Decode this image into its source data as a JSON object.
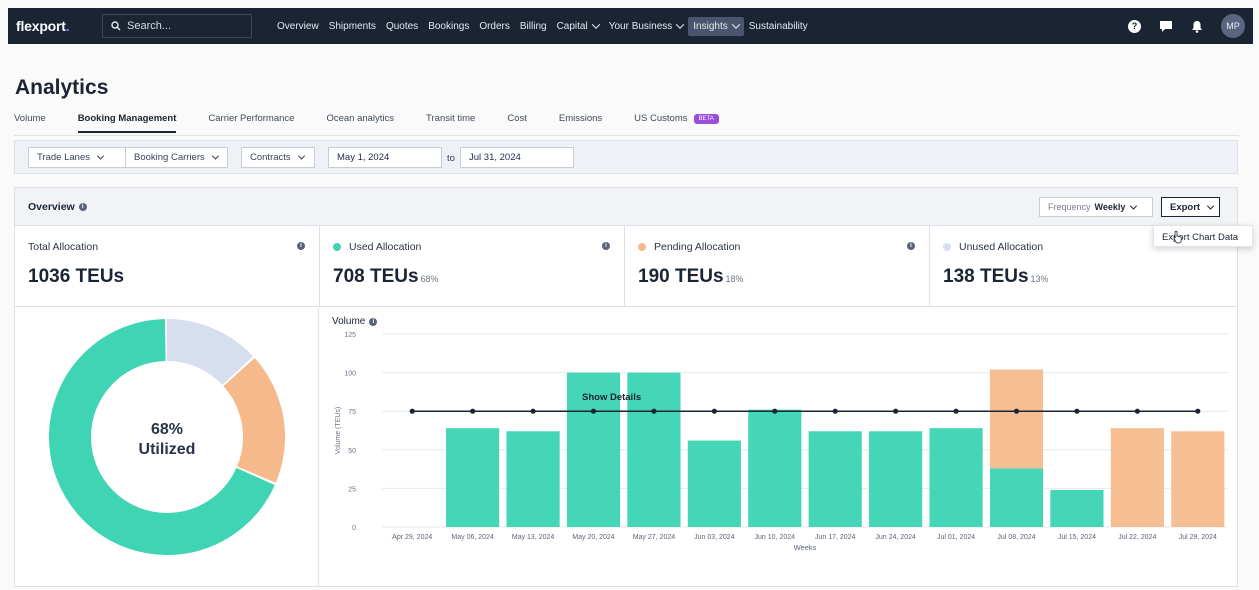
{
  "topbar": {
    "logo": "flexport",
    "logo_dot": ".",
    "search_placeholder": "Search...",
    "nav": [
      {
        "label": "Overview",
        "dropdown": false,
        "active": false
      },
      {
        "label": "Shipments",
        "dropdown": false,
        "active": false
      },
      {
        "label": "Quotes",
        "dropdown": false,
        "active": false
      },
      {
        "label": "Bookings",
        "dropdown": false,
        "active": false
      },
      {
        "label": "Orders",
        "dropdown": false,
        "active": false
      },
      {
        "label": "Billing",
        "dropdown": false,
        "active": false
      },
      {
        "label": "Capital",
        "dropdown": true,
        "active": false
      },
      {
        "label": "Your Business",
        "dropdown": true,
        "active": false
      },
      {
        "label": "Insights",
        "dropdown": true,
        "active": true
      },
      {
        "label": "Sustainability",
        "dropdown": false,
        "active": false
      }
    ],
    "help_glyph": "?",
    "avatar_initials": "MP"
  },
  "page": {
    "title": "Analytics",
    "tabs": [
      {
        "label": "Volume",
        "active": false
      },
      {
        "label": "Booking Management",
        "active": true
      },
      {
        "label": "Carrier Performance",
        "active": false
      },
      {
        "label": "Ocean analytics",
        "active": false
      },
      {
        "label": "Transit time",
        "active": false
      },
      {
        "label": "Cost",
        "active": false
      },
      {
        "label": "Emissions",
        "active": false
      },
      {
        "label": "US Customs",
        "active": false,
        "badge": "BETA"
      }
    ]
  },
  "filters": {
    "trade_lanes": "Trade Lanes",
    "booking_carriers": "Booking Carriers",
    "contracts": "Contracts",
    "start_date": "May 1, 2024",
    "to_label": "to",
    "end_date": "Jul 31, 2024"
  },
  "overview": {
    "title": "Overview",
    "info_glyph": "i",
    "frequency_label": "Frequency",
    "frequency_value": "Weekly",
    "export_label": "Export",
    "export_menu": [
      "Export Chart Data"
    ]
  },
  "stats": [
    {
      "label": "Total Allocation",
      "value": "1036 TEUs",
      "pct": "",
      "dot": ""
    },
    {
      "label": "Used Allocation",
      "value": "708 TEUs",
      "pct": "68%",
      "dot": "#3fd4b4"
    },
    {
      "label": "Pending Allocation",
      "value": "190 TEUs",
      "pct": "18%",
      "dot": "#f5b98b"
    },
    {
      "label": "Unused Allocation",
      "value": "138 TEUs",
      "pct": "13%",
      "dot": "#d6def0"
    }
  ],
  "donut": {
    "pct_label": "68%",
    "sub_label": "Utilized",
    "segments": [
      {
        "name": "Used",
        "value": 708,
        "color": "#3fd4b4"
      },
      {
        "name": "Pending",
        "value": 190,
        "color": "#f5b98b"
      },
      {
        "name": "Unused",
        "value": 138,
        "color": "#d6def0"
      }
    ]
  },
  "chart_data": {
    "type": "bar",
    "title": "Volume",
    "ylabel": "Volume (TEUs)",
    "xlabel": "Weeks",
    "ylim": [
      0,
      125
    ],
    "yticks": [
      0,
      25,
      50,
      75,
      100,
      125
    ],
    "grid": true,
    "categories": [
      "Apr 29, 2024",
      "May 06, 2024",
      "May 13, 2024",
      "May 20, 2024",
      "May 27, 2024",
      "Jun 03, 2024",
      "Jun 10, 2024",
      "Jun 17, 2024",
      "Jun 24, 2024",
      "Jul 01, 2024",
      "Jul 08, 2024",
      "Jul 15, 2024",
      "Jul 22, 2024",
      "Jul 29, 2024"
    ],
    "stacked": true,
    "series": [
      {
        "name": "Used",
        "color": "#44d6b6",
        "values": [
          0,
          64,
          62,
          100,
          100,
          56,
          76,
          62,
          62,
          64,
          38,
          24,
          0,
          0
        ]
      },
      {
        "name": "Pending",
        "color": "#f5bf93",
        "values": [
          0,
          0,
          0,
          0,
          0,
          0,
          0,
          0,
          0,
          0,
          64,
          0,
          64,
          62
        ]
      },
      {
        "name": "Allocation",
        "type": "line",
        "color": "#1b2433",
        "values": [
          75,
          75,
          75,
          75,
          75,
          75,
          75,
          75,
          75,
          75,
          75,
          75,
          75,
          75
        ]
      }
    ]
  },
  "footer": {
    "show_details": "Show Details"
  }
}
